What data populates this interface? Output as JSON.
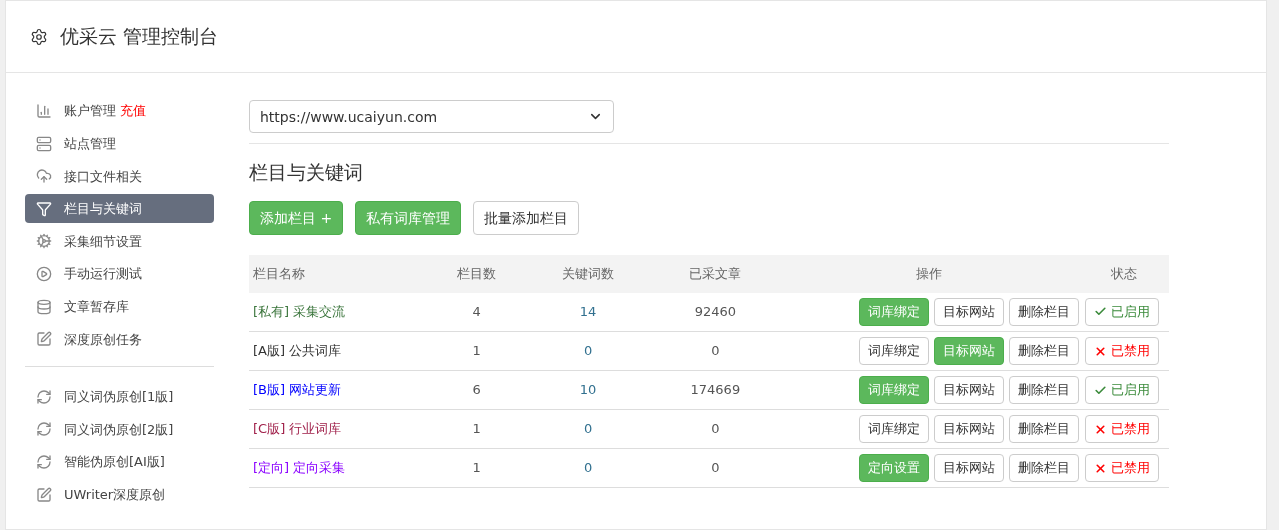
{
  "header": {
    "title": "优采云 管理控制台"
  },
  "sidebar": {
    "sections": [
      [
        {
          "kind": "chart",
          "label": "账户管理",
          "badge": "充值",
          "selected": false
        },
        {
          "kind": "server",
          "label": "站点管理",
          "selected": false
        },
        {
          "kind": "cloud",
          "label": "接口文件相关",
          "selected": false
        },
        {
          "kind": "filter",
          "label": "栏目与关键词",
          "selected": true
        },
        {
          "kind": "gears",
          "label": "采集细节设置",
          "selected": false
        },
        {
          "kind": "play",
          "label": "手动运行测试",
          "selected": false
        },
        {
          "kind": "database",
          "label": "文章暂存库",
          "selected": false
        },
        {
          "kind": "edit",
          "label": "深度原创任务",
          "selected": false
        }
      ],
      [
        {
          "kind": "refresh",
          "label": "同义词伪原创[1版]",
          "selected": false
        },
        {
          "kind": "refresh",
          "label": "同义词伪原创[2版]",
          "selected": false
        },
        {
          "kind": "refresh",
          "label": "智能伪原创[AI版]",
          "selected": false
        },
        {
          "kind": "edit",
          "label": "UWriter深度原创",
          "selected": false
        }
      ]
    ]
  },
  "site_select": {
    "value": "https://www.ucaiyun.com"
  },
  "section_title": "栏目与关键词",
  "toolbar": [
    {
      "label": "添加栏目 +",
      "kind": "primary"
    },
    {
      "label": "私有词库管理",
      "kind": "primary"
    },
    {
      "label": "批量添加栏目",
      "kind": "default"
    }
  ],
  "table": {
    "columns": [
      "栏目名称",
      "栏目数",
      "关键词数",
      "已采文章",
      "操作",
      "状态"
    ],
    "rows": [
      {
        "tag": "[私有]",
        "name": "采集交流",
        "color": "#3c763d",
        "c2": "4",
        "c3": "14",
        "c4": "92460",
        "actions": [
          {
            "label": "词库绑定",
            "kind": "primary"
          },
          {
            "label": "目标网站",
            "kind": "default"
          },
          {
            "label": "删除栏目",
            "kind": "default"
          }
        ],
        "status": {
          "label": "已启用",
          "on": true
        }
      },
      {
        "tag": "[A版]",
        "name": "公共词库",
        "color": "#333333",
        "c2": "1",
        "c3": "0",
        "c4": "0",
        "actions": [
          {
            "label": "词库绑定",
            "kind": "default"
          },
          {
            "label": "目标网站",
            "kind": "primary"
          },
          {
            "label": "删除栏目",
            "kind": "default"
          }
        ],
        "status": {
          "label": "已禁用",
          "on": false
        }
      },
      {
        "tag": "[B版]",
        "name": "网站更新",
        "color": "#0000ff",
        "c2": "6",
        "c3": "10",
        "c4": "174669",
        "actions": [
          {
            "label": "词库绑定",
            "kind": "primary"
          },
          {
            "label": "目标网站",
            "kind": "default"
          },
          {
            "label": "删除栏目",
            "kind": "default"
          }
        ],
        "status": {
          "label": "已启用",
          "on": true
        }
      },
      {
        "tag": "[C版]",
        "name": "行业词库",
        "color": "#a0204a",
        "c2": "1",
        "c3": "0",
        "c4": "0",
        "actions": [
          {
            "label": "词库绑定",
            "kind": "default"
          },
          {
            "label": "目标网站",
            "kind": "default"
          },
          {
            "label": "删除栏目",
            "kind": "default"
          }
        ],
        "status": {
          "label": "已禁用",
          "on": false
        }
      },
      {
        "tag": "[定向]",
        "name": "定向采集",
        "color": "#8a00ff",
        "c2": "1",
        "c3": "0",
        "c4": "0",
        "actions": [
          {
            "label": "定向设置",
            "kind": "primary"
          },
          {
            "label": "目标网站",
            "kind": "default"
          },
          {
            "label": "删除栏目",
            "kind": "default"
          }
        ],
        "status": {
          "label": "已禁用",
          "on": false
        }
      }
    ]
  }
}
